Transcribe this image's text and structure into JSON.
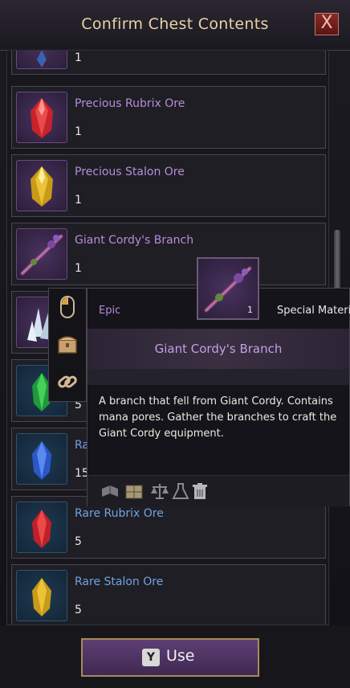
{
  "window": {
    "title": "Confirm Chest Contents",
    "close_glyph": "X"
  },
  "items": [
    {
      "name": "",
      "qty": "1",
      "grade": "purple",
      "icon": "ore-icon"
    },
    {
      "name": "Precious Rubrix Ore",
      "qty": "1",
      "grade": "purple",
      "icon": "red-ore-icon"
    },
    {
      "name": "Precious Stalon Ore",
      "qty": "1",
      "grade": "purple",
      "icon": "yellow-ore-icon"
    },
    {
      "name": "Giant Cordy's Branch",
      "qty": "1",
      "grade": "purple",
      "icon": "branch-icon"
    },
    {
      "name": "",
      "qty": "",
      "grade": "purple",
      "icon": "crystal-icon"
    },
    {
      "name": "",
      "qty": "5",
      "grade": "blue",
      "icon": "green-ore-icon"
    },
    {
      "name": "Ra",
      "qty": "15",
      "grade": "blue",
      "icon": "blue-ore-icon"
    },
    {
      "name": "Rare Rubrix Ore",
      "qty": "5",
      "grade": "blue",
      "icon": "red-ore-icon"
    },
    {
      "name": "Rare Stalon Ore",
      "qty": "5",
      "grade": "blue",
      "icon": "yellow-ore-icon"
    }
  ],
  "context_menu": [
    {
      "icon": "mouse-icon"
    },
    {
      "icon": "chest-icon"
    },
    {
      "icon": "link-icon"
    }
  ],
  "tooltip": {
    "rarity": "Epic",
    "type": "Special Materia",
    "name": "Giant Cordy's Branch",
    "qty": "1",
    "description": "A branch that fell from Giant Cordy. Contains mana pores. Gather the branches to craft the Giant Cordy equipment.",
    "bar_icons": [
      "book-icon",
      "crate-icon",
      "scale-icon",
      "flask-icon",
      "trash-icon"
    ]
  },
  "use_button": {
    "key": "Y",
    "label": "Use"
  },
  "colors": {
    "epic": "#b58ed8",
    "rare": "#6fa3e2",
    "title": "#e7d3a6"
  }
}
